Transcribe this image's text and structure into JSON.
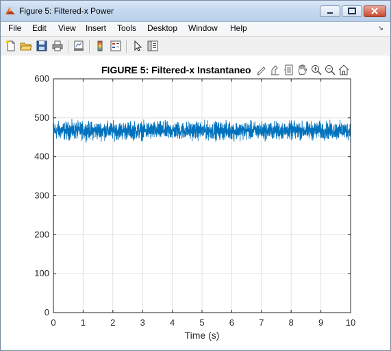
{
  "window": {
    "title": "Figure 5: Filtered-x Power",
    "controls": {
      "minimize": "minimize",
      "maximize": "maximize",
      "close": "close"
    }
  },
  "menubar": {
    "items": [
      "File",
      "Edit",
      "View",
      "Insert",
      "Tools",
      "Desktop",
      "Window",
      "Help"
    ]
  },
  "toolbar": {
    "icons": [
      "new-figure-icon",
      "open-file-icon",
      "save-icon",
      "print-icon",
      "link-plot-icon",
      "colorbar-icon",
      "legend-icon",
      "pointer-icon",
      "property-inspector-icon"
    ]
  },
  "axes_toolbar": {
    "icons": [
      "brush-icon",
      "data-tips-icon",
      "restore-view-icon",
      "pan-icon",
      "zoom-in-icon",
      "zoom-out-icon",
      "home-icon"
    ]
  },
  "chart_data": {
    "type": "line",
    "title": "FIGURE 5: Filtered-x Instantaneo",
    "xlabel": "Time (s)",
    "ylabel": "",
    "xlim": [
      0,
      10
    ],
    "ylim": [
      0,
      600
    ],
    "xticks": [
      "0",
      "1",
      "2",
      "3",
      "4",
      "5",
      "6",
      "7",
      "8",
      "9",
      "10"
    ],
    "yticks": [
      "0",
      "100",
      "200",
      "300",
      "400",
      "500",
      "600"
    ],
    "grid": true,
    "series": [
      {
        "color": "#0072bd",
        "start": {
          "x": 0,
          "y": 0
        },
        "rise_to": 470,
        "mean": 467,
        "upper_envelope": 495,
        "lower_envelope": 442
      }
    ],
    "colors": {
      "line": "#0072bd",
      "grid": "#e0e0e0",
      "axes": "#262626"
    }
  }
}
